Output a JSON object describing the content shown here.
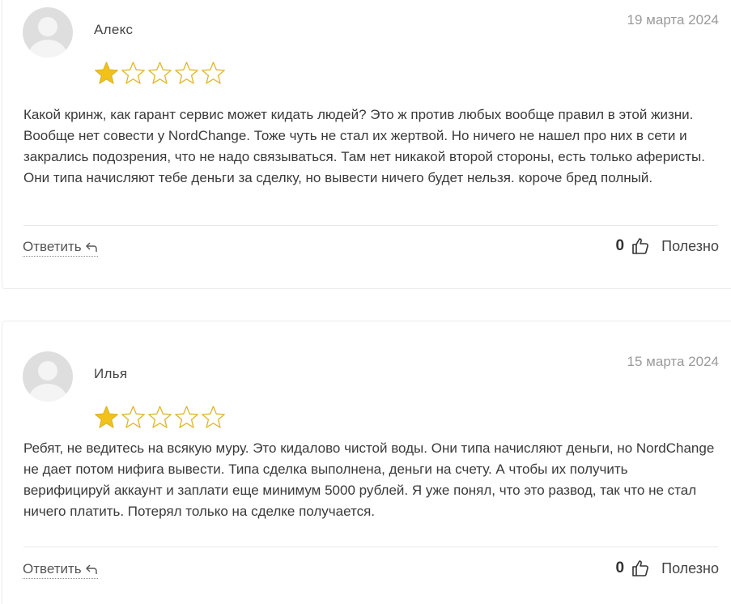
{
  "reviews": [
    {
      "author": "Алекс",
      "date": "19 марта 2024",
      "rating": 1,
      "max_rating": 5,
      "text": "Какой кринж, как гарант сервис может кидать людей? Это ж против любых вообще правил в этой жизни. Вообще нет совести у NordChange. Тоже чуть не стал их жертвой. Но ничего не нашел про них в сети и закрались подозрения, что не надо связываться. Там нет никакой второй стороны, есть только аферисты. Они типа начисляют тебе деньги за сделку, но вывести ничего будет нельзя. короче бред полный.",
      "reply_label": "Ответить",
      "useful_count": "0",
      "useful_label": "Полезно"
    },
    {
      "author": "Илья",
      "date": "15 марта 2024",
      "rating": 1,
      "max_rating": 5,
      "text": "Ребят, не ведитесь на всякую муру. Это кидалово чистой воды. Они типа начисляют деньги, но NordChange не дает потом нифига вывести. Типа сделка выполнена, деньги на счету. А чтобы их получить верифицируй аккаунт и заплати еще минимум 5000 рублей. Я уже понял, что это развод, так что не стал ничего платить. Потерял только на сделке получается.",
      "reply_label": "Ответить",
      "useful_count": "0",
      "useful_label": "Полезно"
    }
  ],
  "colors": {
    "star_fill": "#f2c21b",
    "star_outline": "#e0b52a",
    "avatar_bg": "#dedede",
    "avatar_figure": "#f4f4f4"
  },
  "icons": {
    "avatar": "user-silhouette-icon",
    "star": "star-icon",
    "reply": "reply-arrow-icon",
    "useful": "thumbs-up-icon"
  }
}
